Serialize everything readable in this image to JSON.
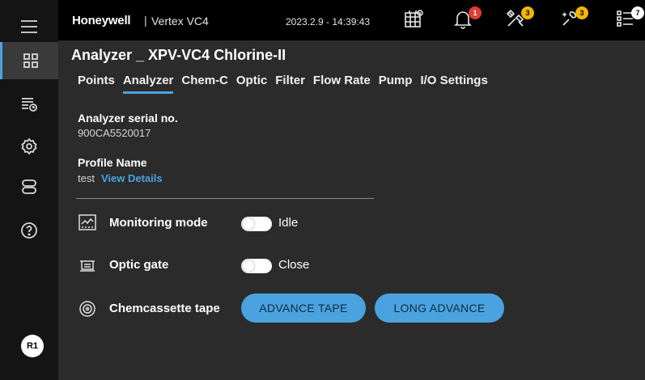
{
  "header": {
    "brand": "Honeywell",
    "separator": "|",
    "product": "Vertex VC4",
    "datetime": "2023.2.9 - 14:39:43",
    "notification_counts": {
      "alarms": "1",
      "maintenance": "3",
      "faults": "3",
      "events": "7"
    }
  },
  "sidebar": {
    "items": [
      {
        "name": "menu-icon"
      },
      {
        "name": "dashboard-icon",
        "active": true
      },
      {
        "name": "event-list-icon"
      },
      {
        "name": "settings-gear-icon"
      },
      {
        "name": "storage-icon"
      },
      {
        "name": "help-icon"
      }
    ],
    "user_badge": "R1"
  },
  "page": {
    "title": "Analyzer _ XPV-VC4 Chlorine-II",
    "tabs": [
      "Points",
      "Analyzer",
      "Chem-C",
      "Optic",
      "Filter",
      "Flow Rate",
      "Pump",
      "I/O Settings"
    ],
    "active_tab": "Analyzer"
  },
  "analyzer": {
    "serial_label": "Analyzer serial no.",
    "serial_value": "900CA5520017",
    "profile_label": "Profile Name",
    "profile_value": "test",
    "view_details": "View Details"
  },
  "controls": {
    "monitoring_label": "Monitoring mode",
    "monitoring_state": "Idle",
    "optic_label": "Optic gate",
    "optic_state": "Close",
    "tape_label": "Chemcassette tape",
    "advance_tape": "ADVANCE TAPE",
    "long_advance": "LONG ADVANCE"
  },
  "colors": {
    "accent": "#4aa3df",
    "panel": "#2b2b2b",
    "alarm": "#e03c31",
    "warning": "#f2b705"
  }
}
